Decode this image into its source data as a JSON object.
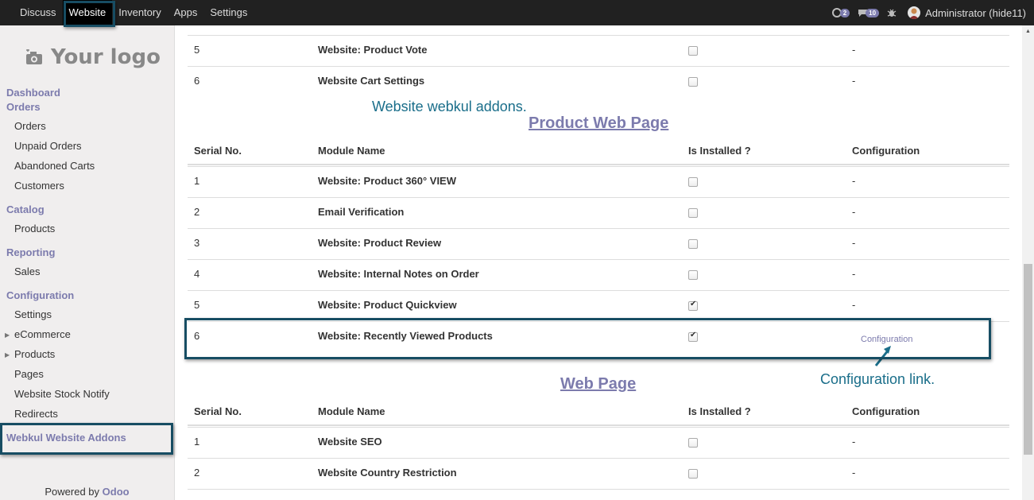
{
  "topbar": {
    "menu": [
      "Discuss",
      "Website",
      "Inventory",
      "Apps",
      "Settings"
    ],
    "active": "Website",
    "chat_count": "2",
    "msg_count": "10",
    "user": "Administrator (hide11)"
  },
  "sidebar": {
    "logo_text": "Your logo",
    "dashboard": "Dashboard",
    "orders_section": "Orders",
    "orders_items": [
      "Orders",
      "Unpaid Orders",
      "Abandoned Carts",
      "Customers"
    ],
    "catalog_section": "Catalog",
    "catalog_items": [
      "Products"
    ],
    "reporting_section": "Reporting",
    "reporting_items": [
      "Sales"
    ],
    "config_section": "Configuration",
    "config_items": [
      "Settings",
      "eCommerce",
      "Products",
      "Pages",
      "Website Stock Notify",
      "Redirects"
    ],
    "webkul_addons": "Webkul Website Addons",
    "powered_by": "Powered by",
    "powered_brand": "Odoo"
  },
  "annotations": {
    "webkul_addons_note": "Website webkul addons.",
    "config_link_note": "Configuration link."
  },
  "table_headers": {
    "serial": "Serial No.",
    "module": "Module Name",
    "installed": "Is Installed ?",
    "config": "Configuration"
  },
  "top_rows": [
    {
      "n": "5",
      "name": "Website: Product Vote",
      "installed": false,
      "config": "-"
    },
    {
      "n": "6",
      "name": "Website Cart Settings",
      "installed": false,
      "config": "-"
    }
  ],
  "product_section": {
    "title": "Product Web Page",
    "rows": [
      {
        "n": "1",
        "name": "Website: Product 360° VIEW",
        "installed": false,
        "config": "-"
      },
      {
        "n": "2",
        "name": "Email Verification",
        "installed": false,
        "config": "-"
      },
      {
        "n": "3",
        "name": "Website: Product Review",
        "installed": false,
        "config": "-"
      },
      {
        "n": "4",
        "name": "Website: Internal Notes on Order",
        "installed": false,
        "config": "-"
      },
      {
        "n": "5",
        "name": "Website: Product Quickview",
        "installed": true,
        "config": "-"
      },
      {
        "n": "6",
        "name": "Website: Recently Viewed Products",
        "installed": true,
        "config": "Configuration"
      }
    ]
  },
  "web_section": {
    "title": "Web Page",
    "rows": [
      {
        "n": "1",
        "name": "Website SEO",
        "installed": false,
        "config": "-"
      },
      {
        "n": "2",
        "name": "Website Country Restriction",
        "installed": false,
        "config": "-"
      }
    ]
  },
  "colors": {
    "accent": "#7c7bad",
    "highlight": "#174d63",
    "annotation": "#1a6e8a"
  }
}
